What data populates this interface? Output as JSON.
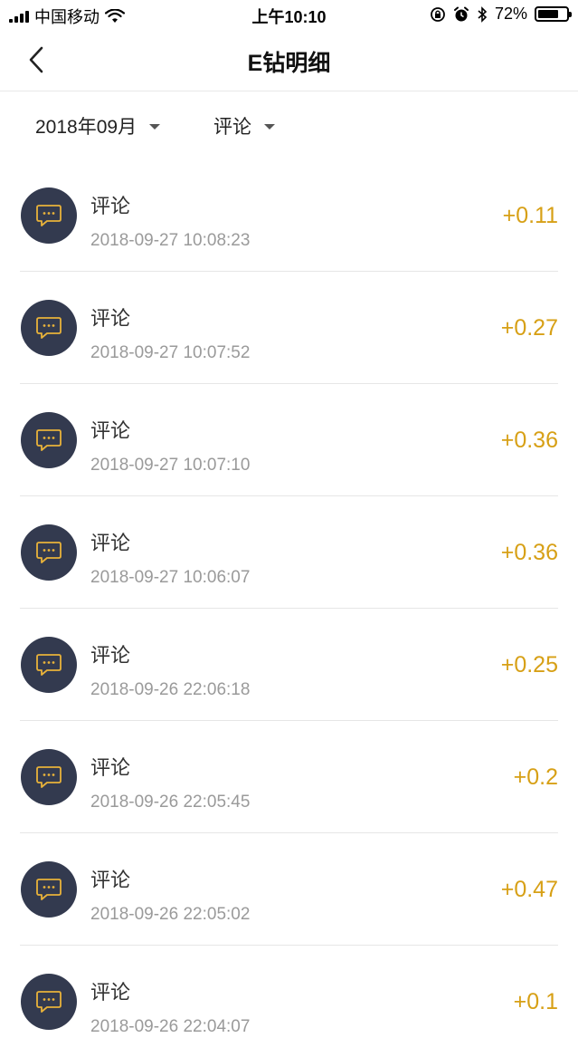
{
  "status": {
    "carrier": "中国移动",
    "time": "上午10:10",
    "battery_text": "72%",
    "battery_level": 0.72
  },
  "nav": {
    "title": "E钻明细"
  },
  "filters": {
    "month": "2018年09月",
    "type": "评论"
  },
  "colors": {
    "accent": "#d7a016",
    "avatar_bg": "#333a4f",
    "icon": "#e8b23a"
  },
  "records": [
    {
      "title": "评论",
      "time": "2018-09-27 10:08:23",
      "amount": "+0.11"
    },
    {
      "title": "评论",
      "time": "2018-09-27 10:07:52",
      "amount": "+0.27"
    },
    {
      "title": "评论",
      "time": "2018-09-27 10:07:10",
      "amount": "+0.36"
    },
    {
      "title": "评论",
      "time": "2018-09-27 10:06:07",
      "amount": "+0.36"
    },
    {
      "title": "评论",
      "time": "2018-09-26 22:06:18",
      "amount": "+0.25"
    },
    {
      "title": "评论",
      "time": "2018-09-26 22:05:45",
      "amount": "+0.2"
    },
    {
      "title": "评论",
      "time": "2018-09-26 22:05:02",
      "amount": "+0.47"
    },
    {
      "title": "评论",
      "time": "2018-09-26 22:04:07",
      "amount": "+0.1"
    }
  ]
}
